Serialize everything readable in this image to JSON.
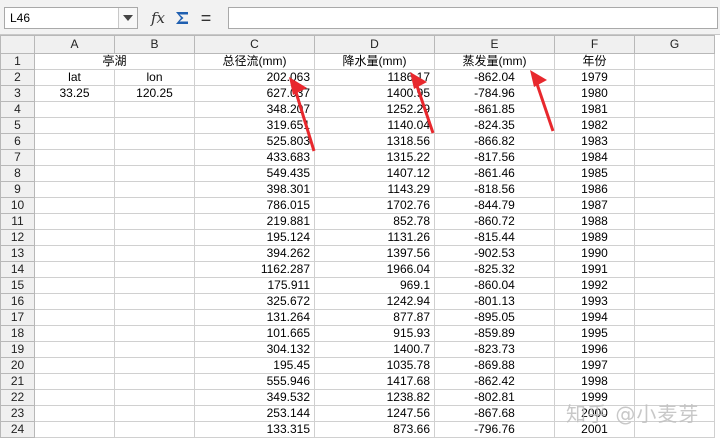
{
  "namebox": {
    "value": "L46"
  },
  "toolbar": {
    "fx_label": "fx",
    "eq_label": "="
  },
  "formula": {
    "value": ""
  },
  "columns": [
    "A",
    "B",
    "C",
    "D",
    "E",
    "F",
    "G"
  ],
  "header_row": {
    "row": "1",
    "merged_AB": "亭湖",
    "C": "总径流(mm)",
    "D": "降水量(mm)",
    "E": "蒸发量(mm)",
    "F": "年份"
  },
  "rows": [
    {
      "r": "2",
      "A": "lat",
      "B": "lon",
      "C": "202.063",
      "D": "1186.17",
      "E": "-862.04",
      "F": "1979"
    },
    {
      "r": "3",
      "A": "33.25",
      "B": "120.25",
      "C": "627.037",
      "D": "1400.95",
      "E": "-784.96",
      "F": "1980"
    },
    {
      "r": "4",
      "A": "",
      "B": "",
      "C": "348.207",
      "D": "1252.29",
      "E": "-861.85",
      "F": "1981"
    },
    {
      "r": "5",
      "A": "",
      "B": "",
      "C": "319.651",
      "D": "1140.04",
      "E": "-824.35",
      "F": "1982"
    },
    {
      "r": "6",
      "A": "",
      "B": "",
      "C": "525.803",
      "D": "1318.56",
      "E": "-866.82",
      "F": "1983"
    },
    {
      "r": "7",
      "A": "",
      "B": "",
      "C": "433.683",
      "D": "1315.22",
      "E": "-817.56",
      "F": "1984"
    },
    {
      "r": "8",
      "A": "",
      "B": "",
      "C": "549.435",
      "D": "1407.12",
      "E": "-861.46",
      "F": "1985"
    },
    {
      "r": "9",
      "A": "",
      "B": "",
      "C": "398.301",
      "D": "1143.29",
      "E": "-818.56",
      "F": "1986"
    },
    {
      "r": "10",
      "A": "",
      "B": "",
      "C": "786.015",
      "D": "1702.76",
      "E": "-844.79",
      "F": "1987"
    },
    {
      "r": "11",
      "A": "",
      "B": "",
      "C": "219.881",
      "D": "852.78",
      "E": "-860.72",
      "F": "1988"
    },
    {
      "r": "12",
      "A": "",
      "B": "",
      "C": "195.124",
      "D": "1131.26",
      "E": "-815.44",
      "F": "1989"
    },
    {
      "r": "13",
      "A": "",
      "B": "",
      "C": "394.262",
      "D": "1397.56",
      "E": "-902.53",
      "F": "1990"
    },
    {
      "r": "14",
      "A": "",
      "B": "",
      "C": "1162.287",
      "D": "1966.04",
      "E": "-825.32",
      "F": "1991"
    },
    {
      "r": "15",
      "A": "",
      "B": "",
      "C": "175.911",
      "D": "969.1",
      "E": "-860.04",
      "F": "1992"
    },
    {
      "r": "16",
      "A": "",
      "B": "",
      "C": "325.672",
      "D": "1242.94",
      "E": "-801.13",
      "F": "1993"
    },
    {
      "r": "17",
      "A": "",
      "B": "",
      "C": "131.264",
      "D": "877.87",
      "E": "-895.05",
      "F": "1994"
    },
    {
      "r": "18",
      "A": "",
      "B": "",
      "C": "101.665",
      "D": "915.93",
      "E": "-859.89",
      "F": "1995"
    },
    {
      "r": "19",
      "A": "",
      "B": "",
      "C": "304.132",
      "D": "1400.7",
      "E": "-823.73",
      "F": "1996"
    },
    {
      "r": "20",
      "A": "",
      "B": "",
      "C": "195.45",
      "D": "1035.78",
      "E": "-869.88",
      "F": "1997"
    },
    {
      "r": "21",
      "A": "",
      "B": "",
      "C": "555.946",
      "D": "1417.68",
      "E": "-862.42",
      "F": "1998"
    },
    {
      "r": "22",
      "A": "",
      "B": "",
      "C": "349.532",
      "D": "1238.82",
      "E": "-802.81",
      "F": "1999"
    },
    {
      "r": "23",
      "A": "",
      "B": "",
      "C": "253.144",
      "D": "1247.56",
      "E": "-867.68",
      "F": "2000"
    },
    {
      "r": "24",
      "A": "",
      "B": "",
      "C": "133.315",
      "D": "873.66",
      "E": "-796.76",
      "F": "2001"
    }
  ],
  "annotation_color": "#e8282d",
  "watermark": "知乎 @小麦芽"
}
